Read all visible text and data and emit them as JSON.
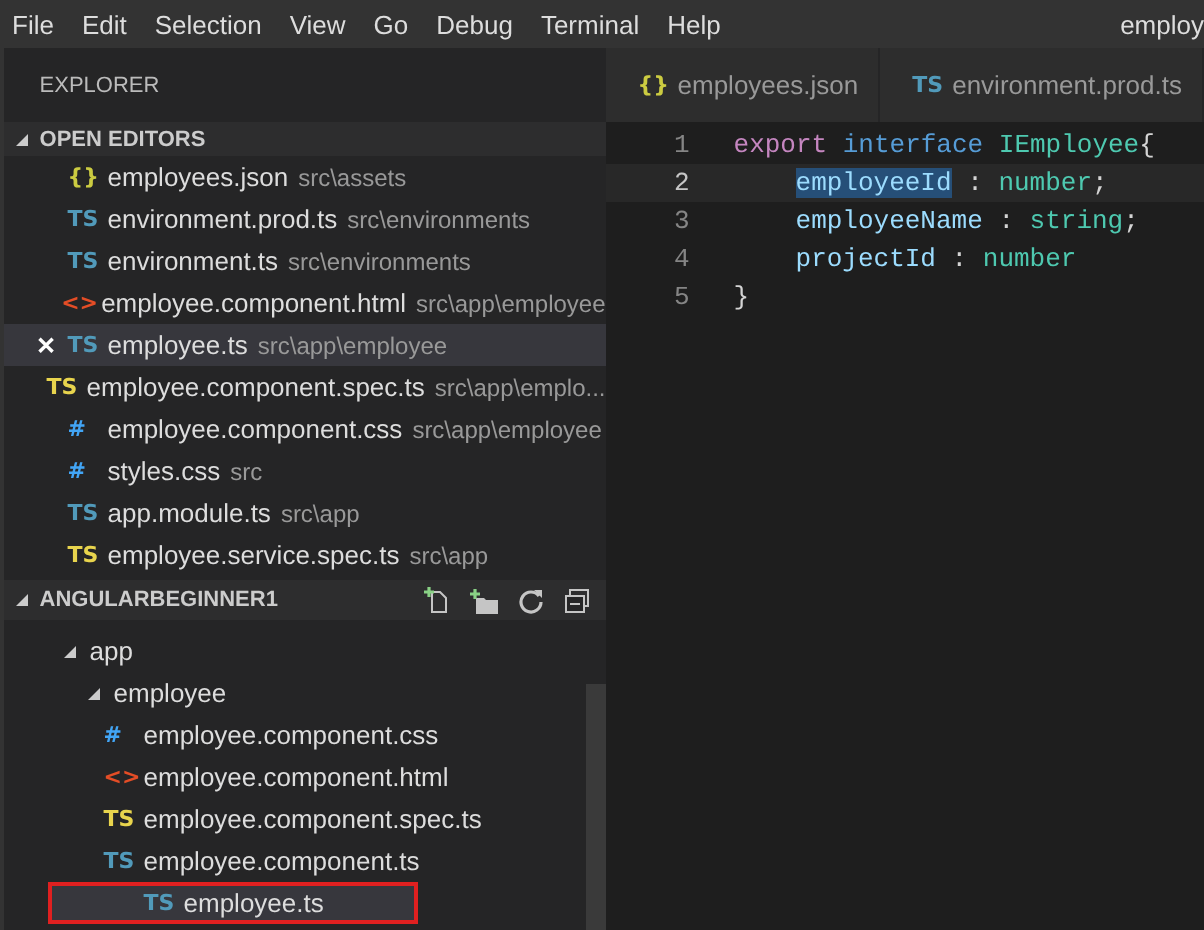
{
  "menu": [
    "File",
    "Edit",
    "Selection",
    "View",
    "Go",
    "Debug",
    "Terminal",
    "Help"
  ],
  "window": {
    "title": "employ"
  },
  "explorer": {
    "title": "EXPLORER",
    "open_editors": {
      "title": "OPEN EDITORS",
      "expanded": true,
      "items": [
        {
          "kind": "json",
          "icon": "{}",
          "name": "employees.json",
          "path": "src\\assets",
          "selected": false
        },
        {
          "kind": "ts",
          "icon": "TS",
          "name": "environment.prod.ts",
          "path": "src\\environments",
          "selected": false
        },
        {
          "kind": "ts",
          "icon": "TS",
          "name": "environment.ts",
          "path": "src\\environments",
          "selected": false
        },
        {
          "kind": "html",
          "icon": "<>",
          "name": "employee.component.html",
          "path": "src\\app\\employee",
          "selected": false
        },
        {
          "kind": "ts",
          "icon": "TS",
          "name": "employee.ts",
          "path": "src\\app\\employee",
          "selected": true,
          "close": "✕"
        },
        {
          "kind": "spec",
          "icon": "TS",
          "name": "employee.component.spec.ts",
          "path": "src\\app\\emplo...",
          "selected": false
        },
        {
          "kind": "css",
          "icon": "#",
          "name": "employee.component.css",
          "path": "src\\app\\employee",
          "selected": false
        },
        {
          "kind": "css",
          "icon": "#",
          "name": "styles.css",
          "path": "src",
          "selected": false
        },
        {
          "kind": "ts",
          "icon": "TS",
          "name": "app.module.ts",
          "path": "src\\app",
          "selected": false
        },
        {
          "kind": "spec",
          "icon": "TS",
          "name": "employee.service.spec.ts",
          "path": "src\\app",
          "selected": false
        }
      ]
    },
    "project": {
      "title": "ANGULARBEGINNER1",
      "expanded": true,
      "tree": [
        {
          "kind": "folder",
          "name": "app",
          "expanded": true,
          "selected": false,
          "children": [
            {
              "kind": "folder",
              "name": "employee",
              "expanded": true,
              "selected": false,
              "children": [
                {
                  "kind": "css",
                  "icon": "#",
                  "name": "employee.component.css",
                  "selected": false
                },
                {
                  "kind": "html",
                  "icon": "<>",
                  "name": "employee.component.html",
                  "selected": false
                },
                {
                  "kind": "spec",
                  "icon": "TS",
                  "name": "employee.component.spec.ts",
                  "selected": false
                },
                {
                  "kind": "ts",
                  "icon": "TS",
                  "name": "employee.component.ts",
                  "selected": false
                },
                {
                  "kind": "ts",
                  "icon": "TS",
                  "name": "employee.ts",
                  "selected": true,
                  "highlighted": true
                }
              ]
            }
          ]
        }
      ]
    }
  },
  "tabs": [
    {
      "kind": "json",
      "icon": "{}",
      "label": "employees.json",
      "selected": false
    },
    {
      "kind": "ts",
      "icon": "TS",
      "label": "environment.prod.ts",
      "selected": false
    }
  ],
  "code": [
    {
      "number": "1",
      "active": false,
      "indented": false,
      "tokens": [
        {
          "kind": "keyword",
          "t": "export "
        },
        {
          "kind": "storage",
          "t": "interface "
        },
        {
          "kind": "type",
          "t": "IEmployee"
        },
        {
          "kind": "plain",
          "t": "{"
        }
      ]
    },
    {
      "number": "2",
      "active": true,
      "indented": true,
      "tokens": [
        {
          "kind": "selected",
          "t": "employeeId"
        },
        {
          "kind": "plain",
          "t": " : "
        },
        {
          "kind": "type",
          "t": "number"
        },
        {
          "kind": "plain",
          "t": ";"
        }
      ]
    },
    {
      "number": "3",
      "active": false,
      "indented": true,
      "tokens": [
        {
          "kind": "property",
          "t": "employeeName"
        },
        {
          "kind": "plain",
          "t": " : "
        },
        {
          "kind": "type",
          "t": "string"
        },
        {
          "kind": "plain",
          "t": ";"
        }
      ]
    },
    {
      "number": "4",
      "active": false,
      "indented": true,
      "tokens": [
        {
          "kind": "property",
          "t": "projectId"
        },
        {
          "kind": "plain",
          "t": " : "
        },
        {
          "kind": "type",
          "t": "number"
        }
      ]
    },
    {
      "number": "5",
      "active": false,
      "indented": false,
      "tokens": [
        {
          "kind": "plain",
          "t": "}"
        }
      ]
    }
  ]
}
